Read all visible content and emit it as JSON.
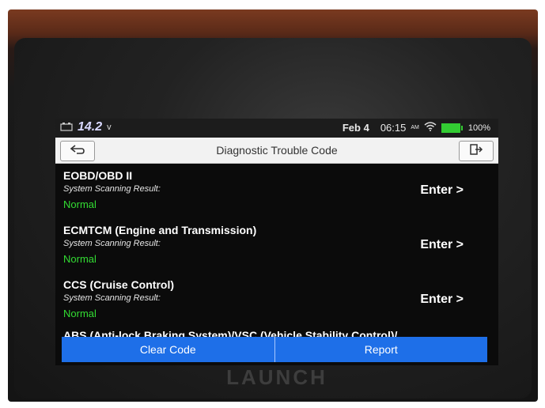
{
  "status_bar": {
    "voltage": "14.2",
    "voltage_unit": "v",
    "date": "Feb 4",
    "time": "06:15",
    "ampm": "AM",
    "battery": "100%"
  },
  "title_bar": {
    "title": "Diagnostic Trouble Code",
    "back_icon": "back-arrow-icon",
    "exit_icon": "exit-icon"
  },
  "systems": [
    {
      "name": "EOBD/OBD II",
      "result_label": "System Scanning Result:",
      "status": "Normal",
      "action": "Enter >"
    },
    {
      "name": "ECMTCM (Engine and Transmission)",
      "result_label": "System Scanning Result:",
      "status": "Normal",
      "action": "Enter >"
    },
    {
      "name": "CCS (Cruise Control)",
      "result_label": "System Scanning Result:",
      "status": "Normal",
      "action": "Enter >"
    },
    {
      "name": "ABS (Anti-lock Braking System)/VSC (Vehicle Stability Control)/",
      "result_label": "",
      "status": "",
      "action": ""
    }
  ],
  "footer": {
    "clear_label": "Clear Code",
    "report_label": "Report"
  },
  "device": {
    "brand": "LAUNCH"
  },
  "colors": {
    "accent": "#1e6fe8",
    "status_ok": "#33dd33",
    "screen_bg": "#0b0b0b"
  }
}
